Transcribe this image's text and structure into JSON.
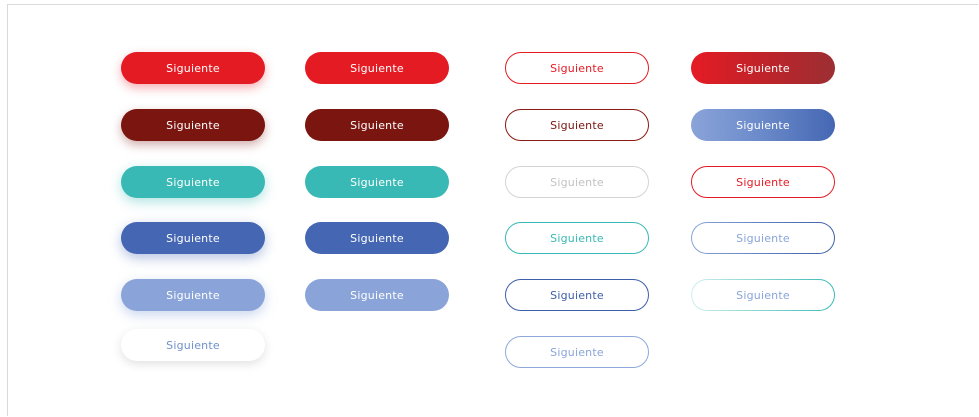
{
  "buttons": {
    "label": "Siguiente",
    "col1": [
      "Siguiente",
      "Siguiente",
      "Siguiente",
      "Siguiente",
      "Siguiente",
      "Siguiente"
    ],
    "col2": [
      "Siguiente",
      "Siguiente",
      "Siguiente",
      "Siguiente",
      "Siguiente"
    ],
    "col3": [
      "Siguiente",
      "Siguiente",
      "Siguiente",
      "Siguiente",
      "Siguiente",
      "Siguiente"
    ],
    "col4": [
      "Siguiente",
      "Siguiente",
      "Siguiente",
      "Siguiente",
      "Siguiente"
    ]
  },
  "colors": {
    "red": "#e51b24",
    "maroon": "#7a1510",
    "teal": "#39b9b5",
    "blue": "#4567b3",
    "light_blue": "#8aa4d9",
    "grey": "#d4d4d4",
    "white": "#ffffff"
  }
}
